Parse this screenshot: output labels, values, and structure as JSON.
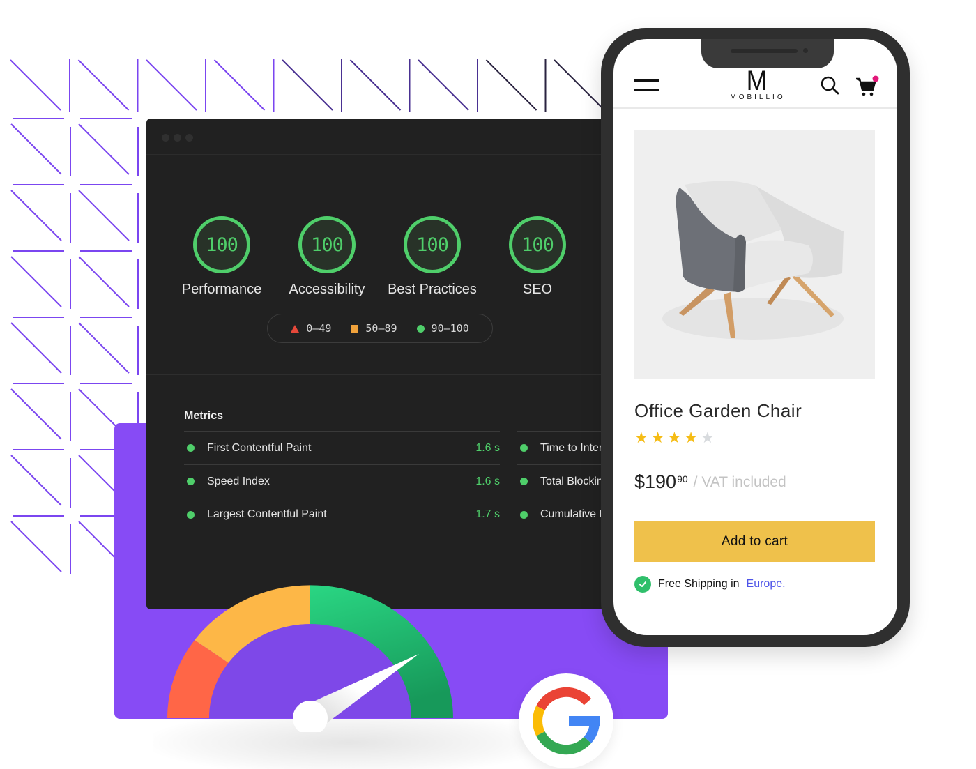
{
  "colors": {
    "pattern_line": "#7b46f0",
    "purple_card": "#874bf5",
    "score_green": "#4fce6a",
    "score_red": "#e5483a",
    "score_orange": "#f0a23b",
    "speedo_red": "#ff6647",
    "speedo_yellow": "#fdb747",
    "speedo_green_light": "#2ad683",
    "speedo_green_dark": "#17995a",
    "speedo_inner": "#7e48e8",
    "button_yellow": "#efc14b",
    "link_blue": "#4e54e8",
    "cart_badge": "#e2187a"
  },
  "lighthouse": {
    "scores": [
      {
        "label": "Performance",
        "value": "100"
      },
      {
        "label": "Accessibility",
        "value": "100"
      },
      {
        "label": "Best Practices",
        "value": "100"
      },
      {
        "label": "SEO",
        "value": "100"
      }
    ],
    "legend": [
      {
        "shape": "triangle",
        "range": "0–49"
      },
      {
        "shape": "square",
        "range": "50–89"
      },
      {
        "shape": "circle",
        "range": "90–100"
      }
    ],
    "metrics_title": "Metrics",
    "metrics_left": [
      {
        "name": "First Contentful Paint",
        "value": "1.6 s"
      },
      {
        "name": "Speed Index",
        "value": "1.6 s"
      },
      {
        "name": "Largest Contentful Paint",
        "value": "1.7 s"
      }
    ],
    "metrics_right": [
      {
        "name": "Time to Interactive"
      },
      {
        "name": "Total Blocking Time"
      },
      {
        "name": "Cumulative Layout Shift"
      }
    ]
  },
  "speedometer": {
    "needle_fraction": 0.82
  },
  "phone": {
    "brand_mark": "M",
    "brand_name": "MOBILLIO",
    "icons": {
      "menu": "hamburger-icon",
      "search": "search-icon",
      "cart": "cart-icon"
    },
    "cart_has_badge": true,
    "product": {
      "title": "Office Garden Chair",
      "rating": 4,
      "rating_max": 5,
      "price_main": "$190",
      "price_cents": "90",
      "price_note": "/ VAT included",
      "add_to_cart": "Add to cart",
      "shipping_text": "Free Shipping in",
      "shipping_link": "Europe."
    }
  }
}
